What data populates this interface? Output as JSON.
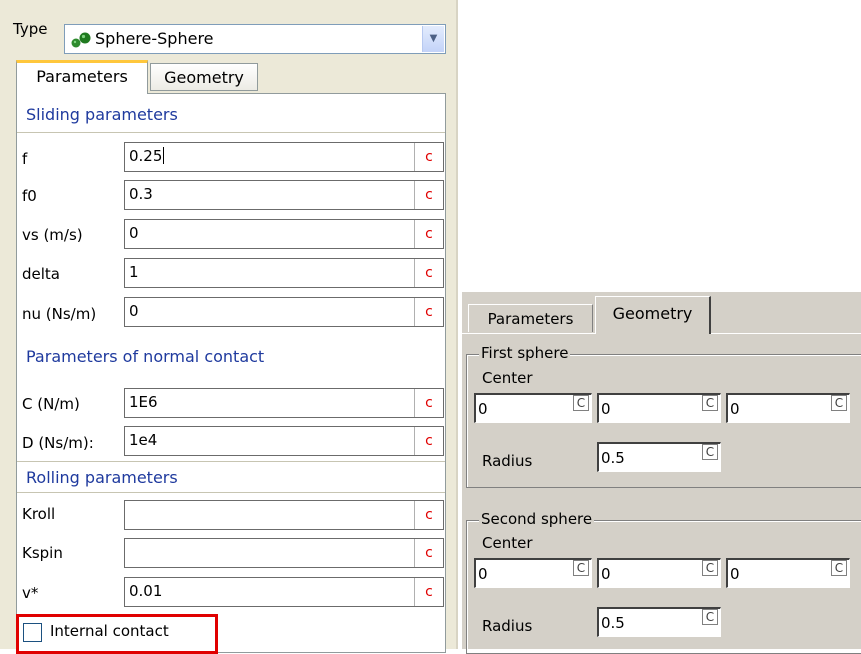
{
  "left": {
    "type_label": "Type",
    "type_value": "Sphere-Sphere",
    "tabs": [
      {
        "label": "Parameters"
      },
      {
        "label": "Geometry"
      }
    ],
    "sliding_title": "Sliding parameters",
    "sliding": [
      {
        "label": "f",
        "value": "0.25"
      },
      {
        "label": "f0",
        "value": "0.3"
      },
      {
        "label": "vs (m/s)",
        "value": "0"
      },
      {
        "label": "delta",
        "value": "1"
      },
      {
        "label": "nu (Ns/m)",
        "value": "0"
      }
    ],
    "normal_title": "Parameters of normal contact",
    "normal": [
      {
        "label": "C (N/m)",
        "value": "1E6"
      },
      {
        "label": "D (Ns/m):",
        "value": "1e4"
      }
    ],
    "rolling_title": "Rolling parameters",
    "rolling": [
      {
        "label": "Kroll",
        "value": ""
      },
      {
        "label": "Kspin",
        "value": ""
      },
      {
        "label": "v*",
        "value": "0.01"
      }
    ],
    "c_label": "c",
    "internal_contact_label": "Internal contact",
    "internal_contact_checked": false
  },
  "right": {
    "tabs": [
      {
        "label": "Parameters"
      },
      {
        "label": "Geometry"
      }
    ],
    "first_sphere": {
      "title": "First sphere",
      "center_label": "Center",
      "center": [
        "0",
        "0",
        "0"
      ],
      "radius_label": "Radius",
      "radius": "0.5"
    },
    "second_sphere": {
      "title": "Second sphere",
      "center_label": "Center",
      "center": [
        "0",
        "0",
        "0"
      ],
      "radius_label": "Radius",
      "radius": "0.5"
    },
    "c_label": "C"
  },
  "colors": {
    "section_title": "#1f3a9e",
    "c_button": "#e00000",
    "highlight": "#e00000",
    "tab_accent": "#ffc73c",
    "classic_gray": "#d4d0c8"
  },
  "icons": {
    "type_icon": "two-green-spheres-icon",
    "combo_arrow": "chevron-down-icon"
  }
}
